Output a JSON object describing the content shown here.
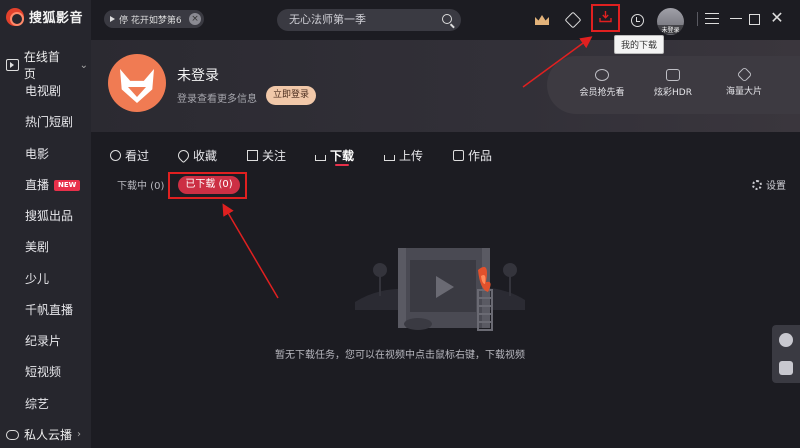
{
  "app": {
    "name": "搜狐影音"
  },
  "sidebar": {
    "home": {
      "label": "在线首页",
      "icon": "play-square-icon"
    },
    "items": [
      {
        "label": "电视剧"
      },
      {
        "label": "热门短剧"
      },
      {
        "label": "电影"
      },
      {
        "label": "直播",
        "badge": "NEW"
      },
      {
        "label": "搜狐出品"
      },
      {
        "label": "美剧"
      },
      {
        "label": "少儿"
      },
      {
        "label": "千帆直播"
      },
      {
        "label": "纪录片"
      },
      {
        "label": "短视频"
      },
      {
        "label": "综艺"
      }
    ],
    "cloud": {
      "label": "私人云播",
      "icon": "cloud-icon"
    }
  },
  "topbar": {
    "now_playing": "停 花开如梦第6",
    "search_placeholder": "无心法师第一季",
    "avatar_label": "未登录",
    "tooltip": "我的下载"
  },
  "profile": {
    "name": "未登录",
    "subtitle": "登录查看更多信息",
    "login_button": "立即登录"
  },
  "vip": [
    {
      "label": "会员抢先看",
      "icon": "play-circle-icon"
    },
    {
      "label": "炫彩HDR",
      "icon": "hd-icon"
    },
    {
      "label": "海量大片",
      "icon": "cube-icon"
    }
  ],
  "tabs": [
    {
      "label": "看过",
      "icon": "clock-icon"
    },
    {
      "label": "收藏",
      "icon": "heart-icon"
    },
    {
      "label": "关注",
      "icon": "plus-square-icon"
    },
    {
      "label": "下载",
      "icon": "download-icon",
      "active": true
    },
    {
      "label": "上传",
      "icon": "upload-icon"
    },
    {
      "label": "作品",
      "icon": "video-icon"
    }
  ],
  "subtabs": {
    "downloading": "下载中 (0)",
    "downloaded": "已下载 (0)",
    "settings": "设置"
  },
  "empty_message": "暂无下载任务，您可以在视频中点击鼠标右键，下载视频",
  "colors": {
    "accent": "#cc2f44",
    "annotation": "#e02020",
    "sidebar_bg": "#26262d",
    "content_bg": "#1c1c22"
  }
}
